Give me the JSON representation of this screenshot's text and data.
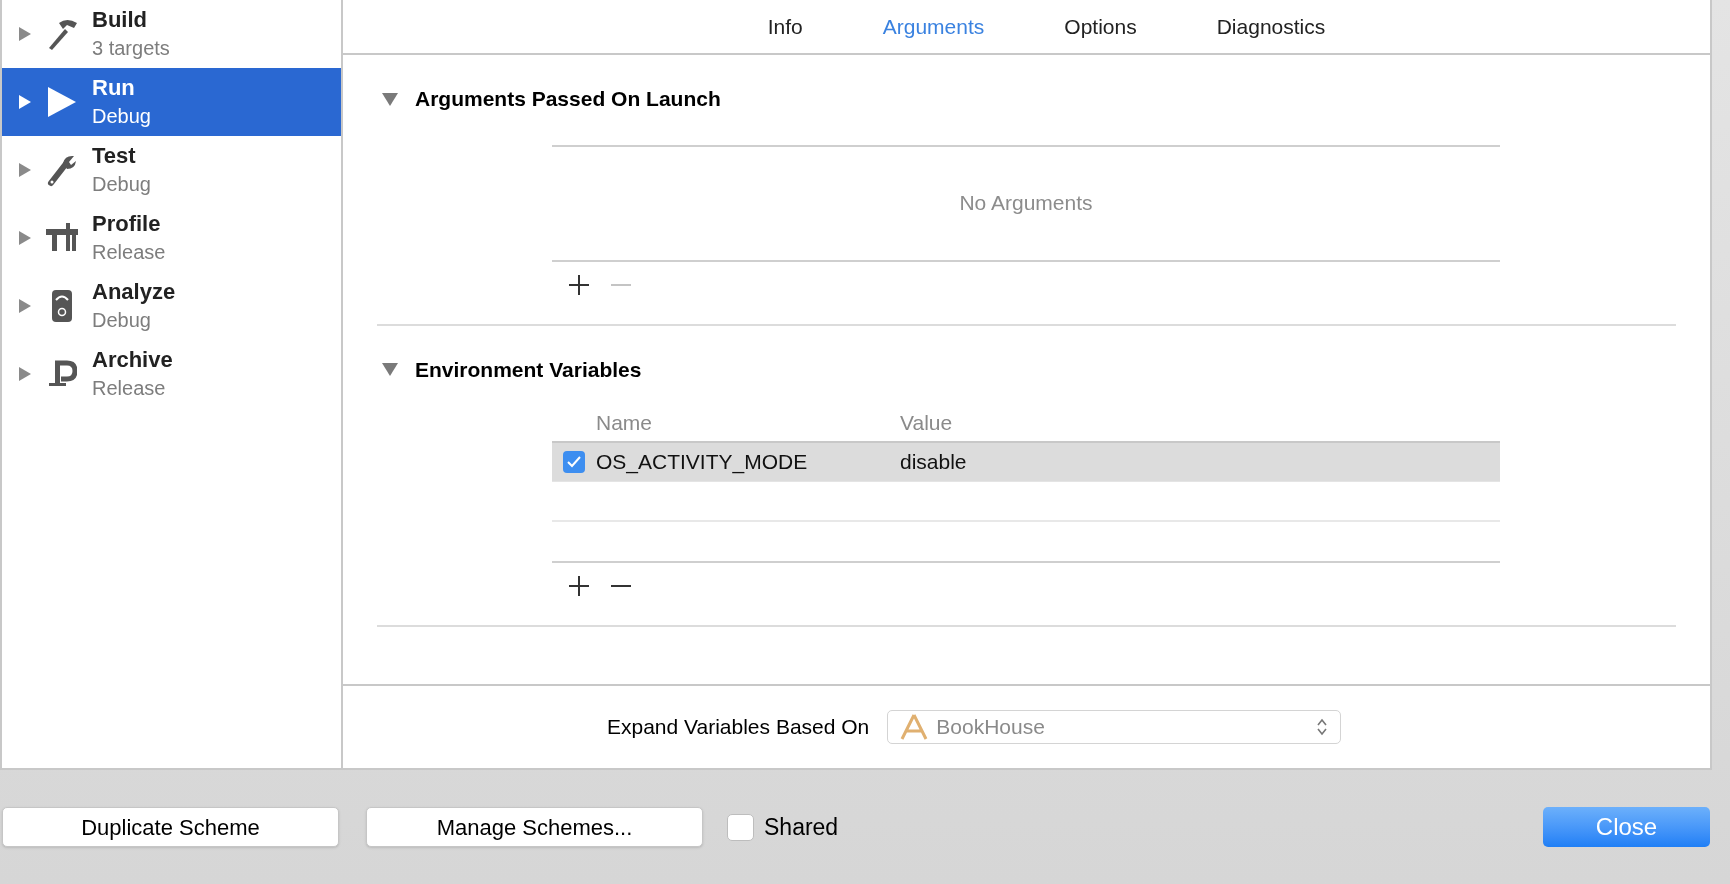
{
  "sidebar": {
    "items": [
      {
        "title": "Build",
        "subtitle": "3 targets",
        "kind": "build",
        "selected": false
      },
      {
        "title": "Run",
        "subtitle": "Debug",
        "kind": "run",
        "selected": true
      },
      {
        "title": "Test",
        "subtitle": "Debug",
        "kind": "test",
        "selected": false
      },
      {
        "title": "Profile",
        "subtitle": "Release",
        "kind": "profile",
        "selected": false
      },
      {
        "title": "Analyze",
        "subtitle": "Debug",
        "kind": "analyze",
        "selected": false
      },
      {
        "title": "Archive",
        "subtitle": "Release",
        "kind": "archive",
        "selected": false
      }
    ]
  },
  "tabs": [
    {
      "label": "Info",
      "selected": false
    },
    {
      "label": "Arguments",
      "selected": true
    },
    {
      "label": "Options",
      "selected": false
    },
    {
      "label": "Diagnostics",
      "selected": false
    }
  ],
  "arguments_section": {
    "title": "Arguments Passed On Launch",
    "expanded": true,
    "empty_text": "No Arguments",
    "remove_enabled": false
  },
  "environment_section": {
    "title": "Environment Variables",
    "expanded": true,
    "columns": [
      "Name",
      "Value"
    ],
    "rows": [
      {
        "name": "OS_ACTIVITY_MODE",
        "value": "disable",
        "checked": true,
        "selected": true
      }
    ],
    "remove_enabled": true
  },
  "expand_variables": {
    "label": "Expand Variables Based On",
    "value": "BookHouse"
  },
  "footer": {
    "duplicate_button": "Duplicate Scheme",
    "manage_button": "Manage Schemes...",
    "shared": {
      "label": "Shared",
      "checked": false
    },
    "close_button": "Close"
  }
}
